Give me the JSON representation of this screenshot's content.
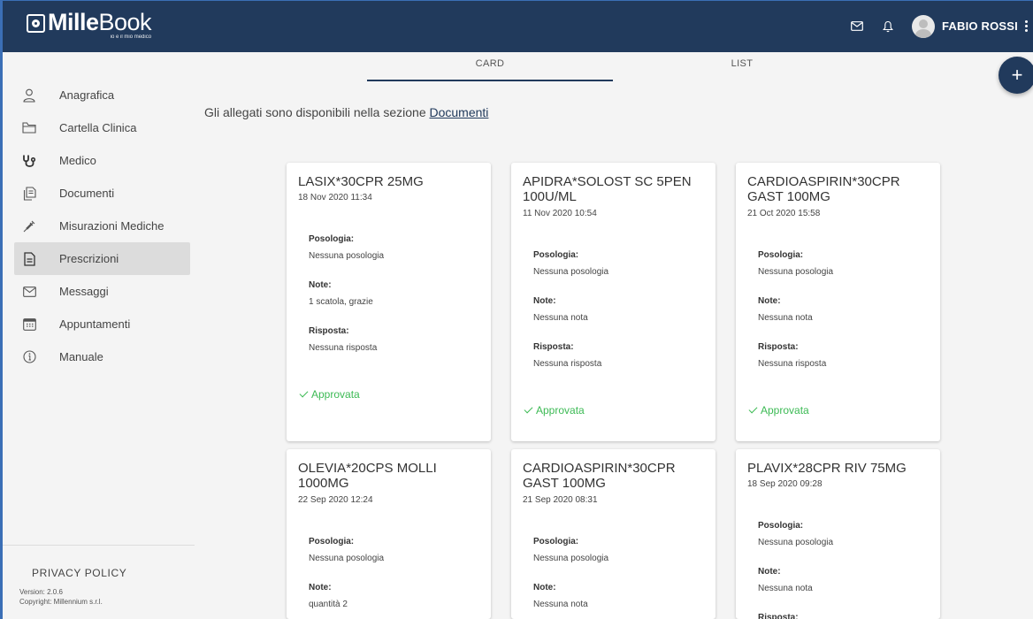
{
  "app": {
    "logo_strong": "Mille",
    "logo_light": "Book",
    "logo_tagline": "io e il mio medico",
    "user_name": "FABIO ROSSI",
    "brand_color": "#213a5c"
  },
  "sidebar": {
    "items": [
      {
        "label": "Anagrafica",
        "icon": "person-icon"
      },
      {
        "label": "Cartella Clinica",
        "icon": "folder-icon"
      },
      {
        "label": "Medico",
        "icon": "stethoscope-icon"
      },
      {
        "label": "Documenti",
        "icon": "documents-icon"
      },
      {
        "label": "Misurazioni Mediche",
        "icon": "syringe-icon"
      },
      {
        "label": "Prescrizioni",
        "icon": "prescription-icon",
        "active": true
      },
      {
        "label": "Messaggi",
        "icon": "mail-icon"
      },
      {
        "label": "Appuntamenti",
        "icon": "calendar-icon"
      },
      {
        "label": "Manuale",
        "icon": "info-icon"
      }
    ],
    "privacy": "PRIVACY POLICY",
    "version": "Version: 2.0.6",
    "copyright": "Copyright: Millennium s.r.l."
  },
  "tabs": [
    {
      "label": "CARD",
      "active": true
    },
    {
      "label": "LIST",
      "active": false
    }
  ],
  "info": {
    "text": "Gli allegati sono disponibili nella sezione ",
    "link": "Documenti"
  },
  "labels": {
    "posologia": "Posologia:",
    "note": "Note:",
    "risposta": "Risposta:"
  },
  "cards": [
    {
      "title": "LASIX*30CPR 25MG",
      "date": "18 Nov 2020 11:34",
      "posologia": "Nessuna posologia",
      "note": "1 scatola, grazie",
      "risposta": "Nessuna risposta",
      "status": "Approvata"
    },
    {
      "title": "APIDRA*SOLOST SC 5PEN 100U/ML",
      "date": "11 Nov 2020 10:54",
      "posologia": "Nessuna posologia",
      "note": "Nessuna nota",
      "risposta": "Nessuna risposta",
      "status": "Approvata"
    },
    {
      "title": "CARDIOASPIRIN*30CPR GAST 100MG",
      "date": "21 Oct 2020 15:58",
      "posologia": "Nessuna posologia",
      "note": "Nessuna nota",
      "risposta": "Nessuna risposta",
      "status": "Approvata"
    },
    {
      "title": "OLEVIA*20CPS MOLLI 1000MG",
      "date": "22 Sep 2020 12:24",
      "posologia": "Nessuna posologia",
      "note": "quantità 2"
    },
    {
      "title": "CARDIOASPIRIN*30CPR GAST 100MG",
      "date": "21 Sep 2020 08:31",
      "posologia": "Nessuna posologia",
      "note": "Nessuna nota"
    },
    {
      "title": "PLAVIX*28CPR RIV 75MG",
      "date": "18 Sep 2020 09:28",
      "posologia": "Nessuna posologia",
      "note": "Nessuna nota",
      "risposta_label_only": true
    }
  ],
  "status_color": "#3cba54"
}
